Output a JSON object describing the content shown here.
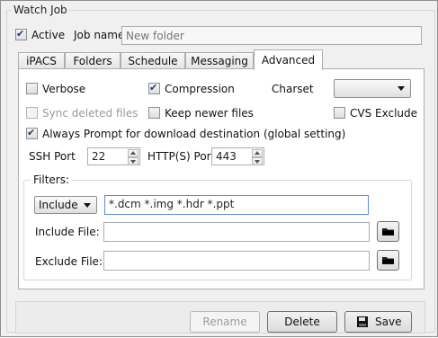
{
  "window": {
    "title": "Watch Job"
  },
  "top": {
    "active_label": "Active",
    "active_checked": true,
    "job_name_label": "Job name",
    "job_name_placeholder": "New folder"
  },
  "tabs": [
    {
      "label": "iPACS"
    },
    {
      "label": "Folders"
    },
    {
      "label": "Schedule"
    },
    {
      "label": "Messaging"
    },
    {
      "label": "Advanced",
      "active": true
    }
  ],
  "advanced": {
    "verbose_label": "Verbose",
    "verbose_checked": false,
    "compression_label": "Compression",
    "compression_checked": true,
    "charset_label": "Charset",
    "charset_value": "",
    "sync_label": "Sync deleted files",
    "sync_checked": false,
    "keep_newer_label": "Keep newer files",
    "keep_newer_checked": false,
    "cvs_label": "CVS Exclude",
    "cvs_checked": false,
    "always_prompt_label": "Always Prompt for download destination (global setting)",
    "always_prompt_checked": true,
    "ssh_label": "SSH Port",
    "ssh_value": "22",
    "https_label": "HTTP(S) Port",
    "https_value": "443"
  },
  "filters": {
    "title": "Filters:",
    "mode_value": "Include",
    "pattern_value": "*.dcm *.img *.hdr *.ppt",
    "include_label": "Include File:",
    "include_value": "",
    "exclude_label": "Exclude File:",
    "exclude_value": ""
  },
  "buttons": {
    "rename": "Rename",
    "delete": "Delete",
    "save": "Save"
  },
  "colors": {
    "tab_border": "#aeaeae",
    "frame_bg": "#f0f0f0",
    "disabled_text": "#9a9a9a"
  }
}
